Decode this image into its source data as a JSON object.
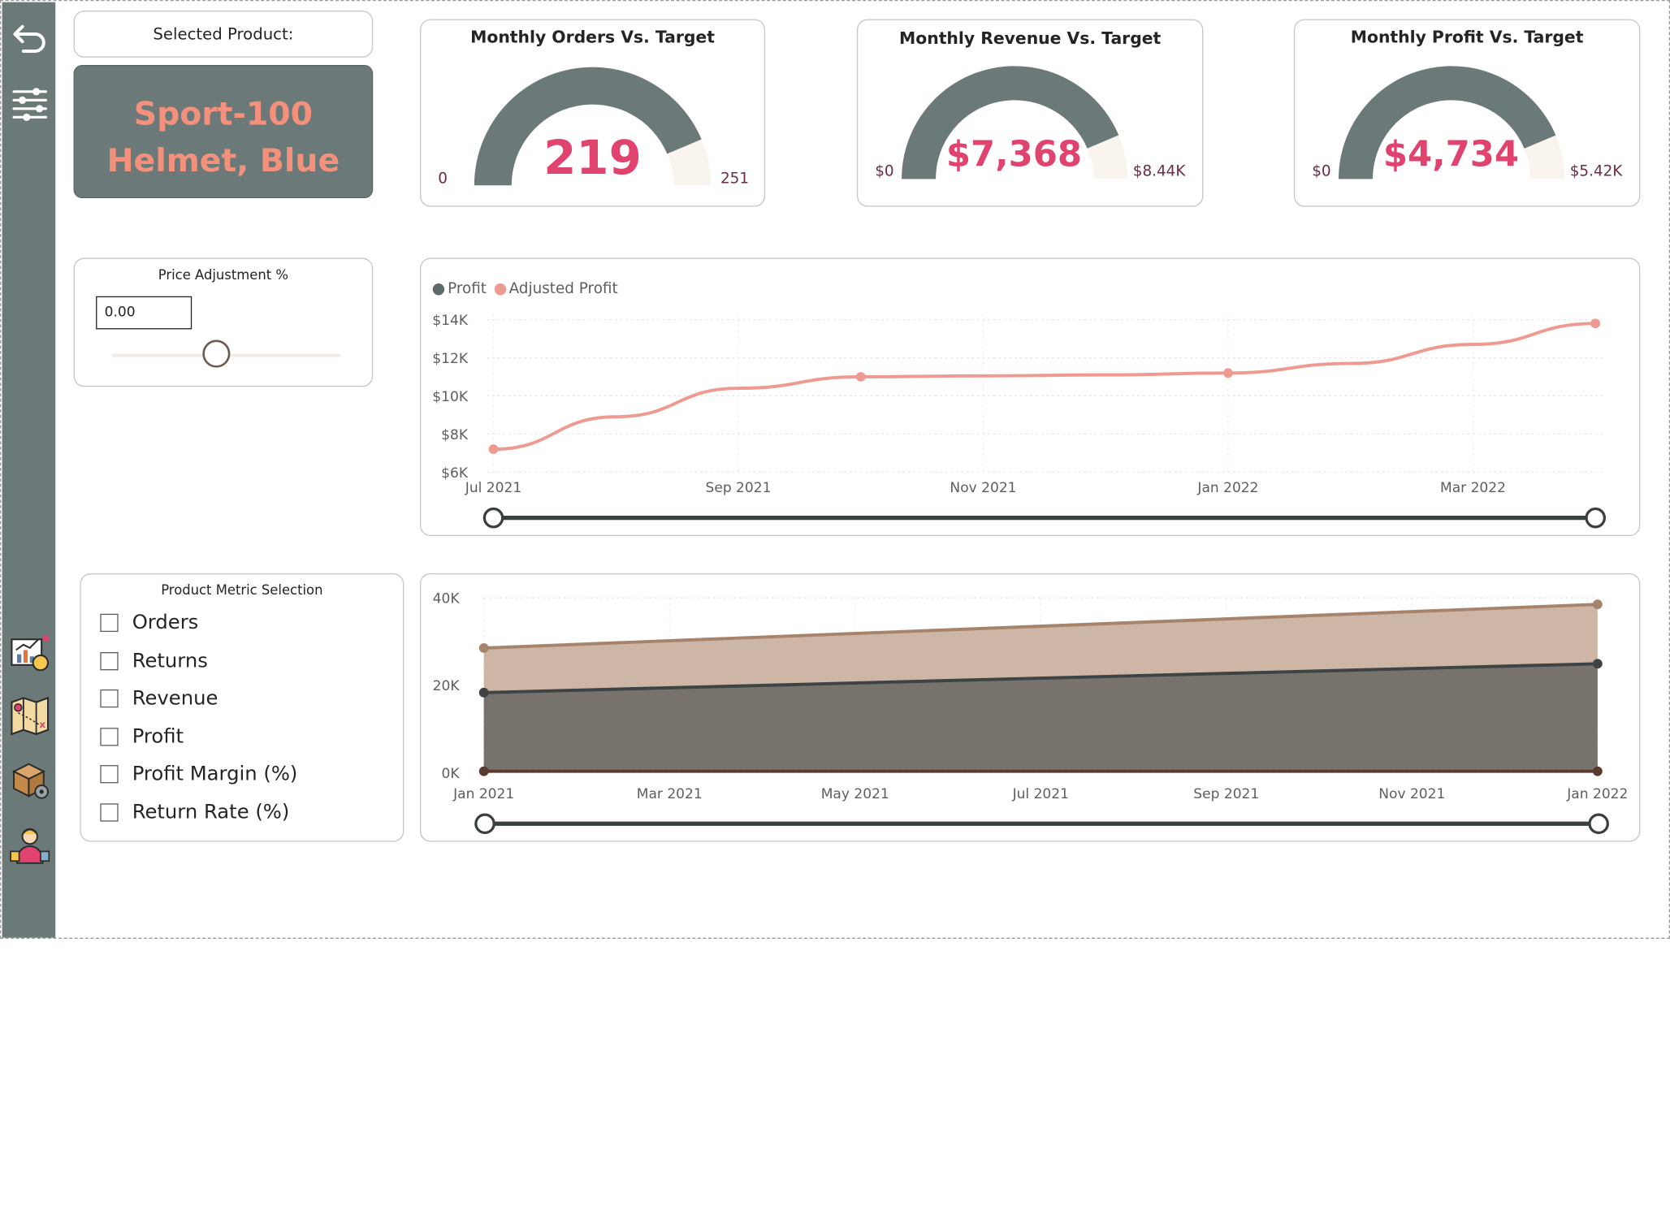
{
  "selected_product": {
    "label": "Selected Product:",
    "name_line1": "Sport-100",
    "name_line2": "Helmet, Blue"
  },
  "gauges": [
    {
      "title": "Monthly Orders Vs. Target",
      "value_label": "219",
      "min_label": "0",
      "max_label": "251",
      "value": 219,
      "max": 251
    },
    {
      "title": "Monthly Revenue Vs. Target",
      "value_label": "$7,368",
      "min_label": "$0",
      "max_label": "$8.44K",
      "value": 7368,
      "max": 8440
    },
    {
      "title": "Monthly Profit Vs. Target",
      "value_label": "$4,734",
      "min_label": "$0",
      "max_label": "$5.42K",
      "value": 4734,
      "max": 5420
    }
  ],
  "price_adjustment": {
    "title": "Price Adjustment %",
    "value": "0.00",
    "slider_fraction": 0.5
  },
  "product_metric": {
    "title": "Product Metric Selection",
    "options": [
      "Orders",
      "Returns",
      "Revenue",
      "Profit",
      "Profit Margin (%)",
      "Return Rate (%)"
    ]
  },
  "colors": {
    "sidebar": "#6b7a79",
    "profit": "#5f6b6a",
    "adjusted_profit": "#ee9a90",
    "gauge_fill": "#6b7a79",
    "gauge_rest": "#faf4ee",
    "accent_value": "#e0436e",
    "selected_name": "#f4917d",
    "area_top": "#cdb6a5",
    "area_top_line": "#a6846c",
    "area_mid": "#77736c",
    "area_mid_line": "#3d4443"
  },
  "icons": [
    "back-arrow-icon",
    "filter-sliders-icon",
    "chart-analytics-icon",
    "map-icon",
    "product-box-icon",
    "customer-icon"
  ],
  "chart_data": [
    {
      "type": "line",
      "title": "",
      "legend": [
        "Profit",
        "Adjusted Profit"
      ],
      "legend_position": "top-left",
      "y_ticks": [
        "$14K",
        "$12K",
        "$10K",
        "$8K",
        "$6K"
      ],
      "ylim": [
        6000,
        14000
      ],
      "x_ticks": [
        "Jul 2021",
        "Sep 2021",
        "Nov 2021",
        "Jan 2022",
        "Mar 2022"
      ],
      "x": [
        "2021-07",
        "2021-08",
        "2021-09",
        "2021-10",
        "2021-11",
        "2021-12",
        "2022-01",
        "2022-02",
        "2022-03",
        "2022-04"
      ],
      "series": [
        {
          "name": "Adjusted Profit",
          "values": [
            7200,
            8900,
            10400,
            11000,
            11050,
            11100,
            11200,
            11700,
            12700,
            13800
          ]
        },
        {
          "name": "Profit",
          "values": [
            7200,
            8900,
            10400,
            11000,
            11050,
            11100,
            11200,
            11700,
            12700,
            13800
          ]
        }
      ],
      "markers_at": [
        "2021-07",
        "2021-10",
        "2022-01",
        "2022-04"
      ],
      "grid": true
    },
    {
      "type": "area",
      "title": "",
      "y_ticks": [
        "40K",
        "20K",
        "0K"
      ],
      "ylim": [
        0,
        40000
      ],
      "x_ticks": [
        "Jan 2021",
        "Mar 2021",
        "May 2021",
        "Jul 2021",
        "Sep 2021",
        "Nov 2021",
        "Jan 2022"
      ],
      "x": [
        "2021-01",
        "2022-01"
      ],
      "series": [
        {
          "values": [
            28500,
            38500
          ]
        },
        {
          "values": [
            18300,
            24900
          ]
        },
        {
          "values": [
            300,
            300
          ]
        }
      ],
      "grid": true
    }
  ]
}
